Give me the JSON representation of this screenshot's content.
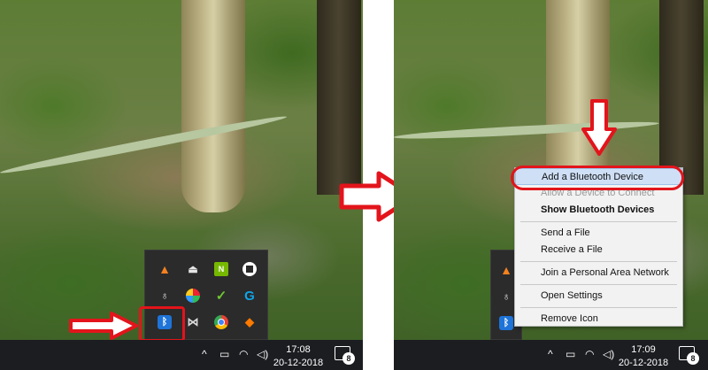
{
  "left_panel": {
    "taskbar": {
      "time": "17:08",
      "date": "20-12-2018",
      "notification_count": "8",
      "chevron": "^"
    },
    "tray_icons": [
      {
        "name": "vlc-icon",
        "glyph": "▲"
      },
      {
        "name": "usb-icon",
        "glyph": "⏏"
      },
      {
        "name": "nvidia-icon",
        "glyph": "N"
      },
      {
        "name": "security-shield-icon",
        "glyph": ""
      },
      {
        "name": "user-avatar-icon",
        "glyph": "♁"
      },
      {
        "name": "color-app-icon",
        "glyph": ""
      },
      {
        "name": "green-app-icon",
        "glyph": "✓"
      },
      {
        "name": "logitech-g-icon",
        "glyph": "G"
      },
      {
        "name": "bluetooth-icon",
        "glyph": "ᛒ"
      },
      {
        "name": "media-icon",
        "glyph": "⋈"
      },
      {
        "name": "chrome-icon",
        "glyph": ""
      },
      {
        "name": "avast-icon",
        "glyph": "◆"
      }
    ]
  },
  "right_panel": {
    "taskbar": {
      "time": "17:09",
      "date": "20-12-2018",
      "notification_count": "8",
      "chevron": "^"
    },
    "context_menu": {
      "items": [
        {
          "label": "Add a Bluetooth Device",
          "style": "highlight"
        },
        {
          "label": "Allow a Device to Connect",
          "style": "dim"
        },
        {
          "label": "Show Bluetooth Devices",
          "style": "bold"
        },
        {
          "separator": true
        },
        {
          "label": "Send a File",
          "style": "normal"
        },
        {
          "label": "Receive a File",
          "style": "normal"
        },
        {
          "separator": true
        },
        {
          "label": "Join a Personal Area Network",
          "style": "normal"
        },
        {
          "separator": true
        },
        {
          "label": "Open Settings",
          "style": "normal"
        },
        {
          "separator": true
        },
        {
          "label": "Remove Icon",
          "style": "normal"
        }
      ]
    }
  },
  "colors": {
    "annotation_red": "#e3141b",
    "taskbar": "#1c1d21",
    "menu_bg": "#f2f2f2",
    "menu_highlight": "#cfe0f6",
    "bluetooth_blue": "#1e74d8"
  }
}
